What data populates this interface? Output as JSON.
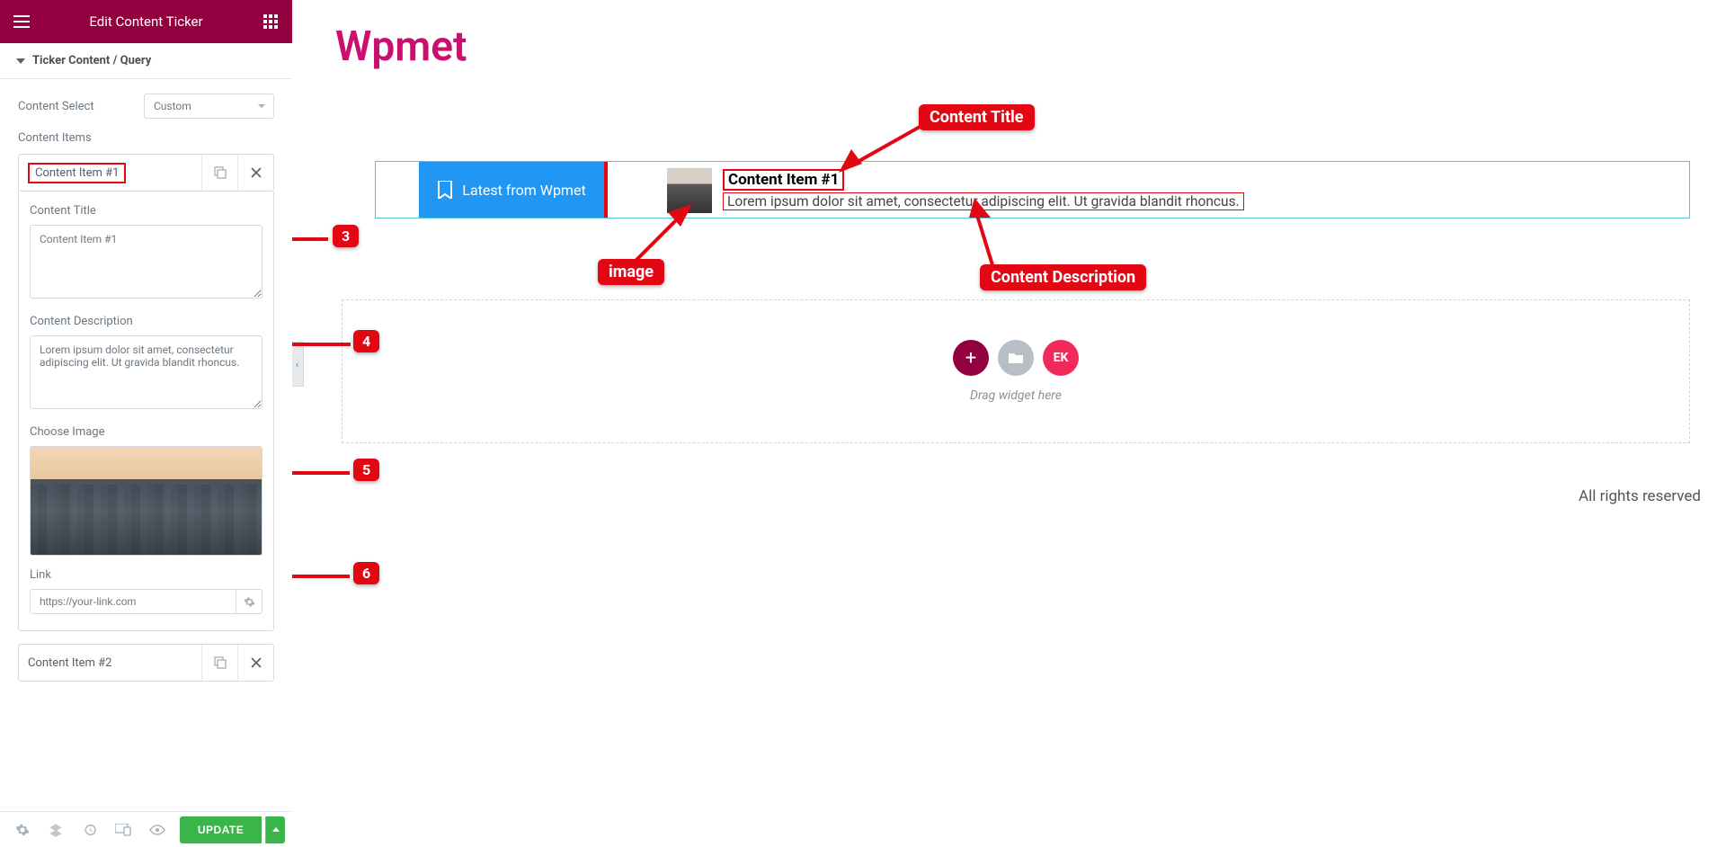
{
  "sidebar": {
    "header_title": "Edit Content Ticker",
    "section_title": "Ticker Content / Query",
    "content_select_label": "Content Select",
    "content_select_value": "Custom",
    "content_items_label": "Content Items",
    "item1_title": "Content Item #1",
    "item2_title": "Content Item #2",
    "fields": {
      "title_label": "Content Title",
      "title_value": "Content Item #1",
      "desc_label": "Content Description",
      "desc_value": "Lorem ipsum dolor sit amet, consectetur adipiscing elit. Ut gravida blandit rhoncus.",
      "image_label": "Choose Image",
      "link_label": "Link",
      "link_placeholder": "https://your-link.com"
    },
    "update_button": "UPDATE"
  },
  "canvas": {
    "page_heading": "Wpmet",
    "ticker_badge": "Latest from Wpmet",
    "ticker_title": "Content Item #1",
    "ticker_desc": "Lorem ipsum dolor sit amet, consectetur adipiscing elit. Ut gravida blandit rhoncus.",
    "dropzone_text": "Drag widget here",
    "ek_label": "EK",
    "footer_note": "All rights reserved"
  },
  "annotations": {
    "n3": "3",
    "n4": "4",
    "n5": "5",
    "n6": "6",
    "a_title": "Content Title",
    "a_image": "image",
    "a_desc": "Content Description"
  }
}
